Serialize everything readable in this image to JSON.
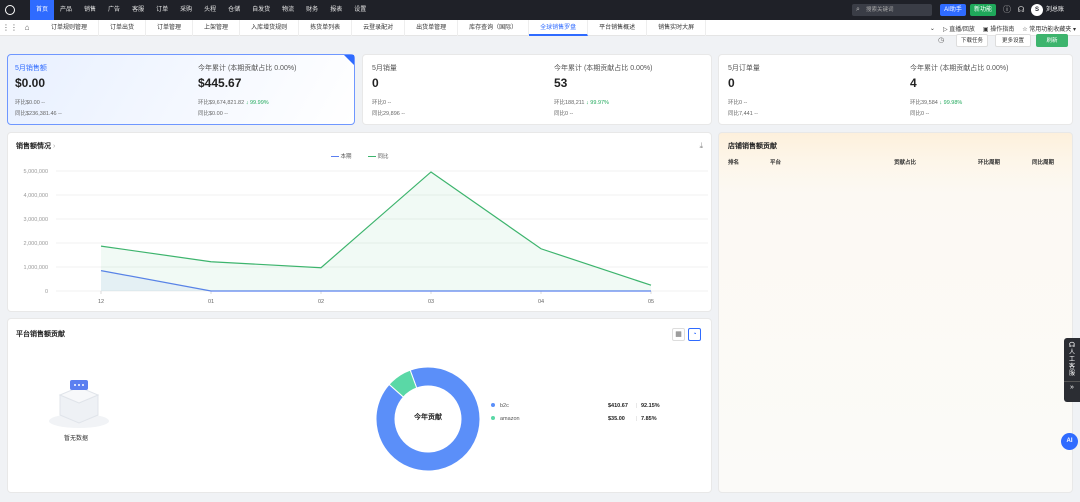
{
  "topnav": {
    "items": [
      "首页",
      "产品",
      "销售",
      "广告",
      "客服",
      "订单",
      "采购",
      "头程",
      "仓储",
      "自发货",
      "物流",
      "财务",
      "报表",
      "设置"
    ],
    "search_placeholder": "搜索关键词",
    "ai": "AI助手",
    "new": "新功能",
    "user_initial": "S",
    "user": "刘总账"
  },
  "tabs": {
    "items": [
      "订单规则管理",
      "订单出货",
      "订单管理",
      "上架管理",
      "入库增货规则",
      "拣货单列表",
      "云登录配对",
      "出货单管理",
      "库存查询（国际）",
      "全球销售罗盘",
      "平台销售概述",
      "销售实时大屏"
    ],
    "active": 9,
    "right": [
      "直播/回放",
      "操作指南",
      "常用功能收藏夹"
    ]
  },
  "sub_buttons": [
    "下载任务",
    "更多设置",
    "刷新"
  ],
  "metrics": [
    {
      "label": "5月销售额",
      "value": "$0.00",
      "mom": "环比$0.00 --",
      "yoy": "同比$236,381.46 --",
      "label2": "今年累计 (本期贡献占比 0.00%)",
      "value2": "$445.67",
      "mom2": "环比$9,674,821.82",
      "mom2_pct": "↓ 99.99%",
      "yoy2": "同比$0.00 --"
    },
    {
      "label": "5月销量",
      "value": "0",
      "mom": "环比0 --",
      "yoy": "同比29,896 --",
      "label2": "今年累计 (本期贡献占比 0.00%)",
      "value2": "53",
      "mom2": "环比188,211",
      "mom2_pct": "↓ 99.97%",
      "yoy2": "同比0 --"
    },
    {
      "label": "5月订单量",
      "value": "0",
      "mom": "环比0 --",
      "yoy": "同比7,441 --",
      "label2": "今年累计 (本期贡献占比 0.00%)",
      "value2": "4",
      "mom2": "环比39,584",
      "mom2_pct": "↓ 99.98%",
      "yoy2": "同比0 --"
    }
  ],
  "sales_panel": {
    "title": "销售额情况",
    "legend": [
      "本期",
      "同比"
    ]
  },
  "chart_data": {
    "type": "line",
    "categories": [
      "12",
      "01",
      "02",
      "03",
      "04",
      "05"
    ],
    "series": [
      {
        "name": "本期",
        "values": [
          850000,
          0,
          0,
          0,
          0,
          0
        ]
      },
      {
        "name": "同比",
        "values": [
          1870000,
          1220000,
          970000,
          4960000,
          1760000,
          240000
        ]
      }
    ],
    "yticks": [
      "5,000,000",
      "4,000,000",
      "3,000,000",
      "2,000,000",
      "1,000,000",
      "0"
    ],
    "ylim": [
      0,
      5000000
    ],
    "colors": {
      "本期": "#5b7ff0",
      "同比": "#3db46d"
    },
    "grid": true
  },
  "store_panel": {
    "title": "店铺销售额贡献",
    "cols": [
      "排名",
      "平台",
      "贡献占比",
      "环比周期",
      "同比周期"
    ]
  },
  "platform_panel": {
    "title": "平台销售额贡献",
    "empty": "暂无数据",
    "center": "今年贡献",
    "items": [
      {
        "name": "b2c",
        "amount": "$410.67",
        "pct": "92.15%",
        "color": "#5b8ff9",
        "value": 92.15
      },
      {
        "name": "amazon",
        "amount": "$35.00",
        "pct": "7.85%",
        "color": "#5ad8a6",
        "value": 7.85
      }
    ]
  },
  "side": {
    "service": "人工客服",
    "ai": "AI"
  }
}
